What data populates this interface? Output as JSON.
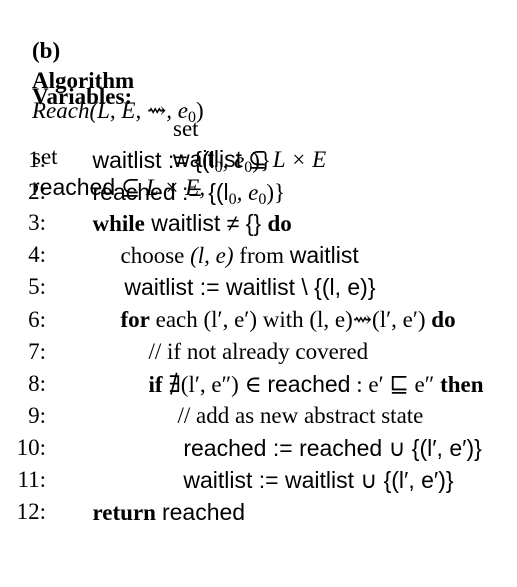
{
  "caption": {
    "label": "(b)",
    "keyword": "Algorithm",
    "name": "Reach",
    "params": "(L, E, ⇝, e",
    "param_sub": "0",
    "close": ")"
  },
  "variables": {
    "keyword": "Variables:",
    "line1_set": "set",
    "line1_name": "reached",
    "line1_rest": " ⊆ L × E,",
    "line2_set": "set",
    "line2_name": "waitlist",
    "line2_rest": " ⊆ L × E"
  },
  "lines": [
    {
      "num": "1:",
      "a": "waitlist := {(l",
      "a_sub": "0",
      "b": ", e",
      "b_sub": "0",
      "c": ")}"
    },
    {
      "num": "2:",
      "a": "reached := {(l",
      "a_sub": "0",
      "b": ", e",
      "b_sub": "0",
      "c": ")}"
    },
    {
      "num": "3:",
      "kw": "while",
      "a": " waitlist ≠ {} ",
      "kw2": "do"
    },
    {
      "num": "4:",
      "a": "choose ",
      "b": "(l, e)",
      "c": " from ",
      "d": "waitlist"
    },
    {
      "num": "5:",
      "a": "waitlist := waitlist \\ {(l, e)}"
    },
    {
      "num": "6:",
      "kw": "for",
      "a": " each (l′, e′) with (l, e)⇝(l′, e′) ",
      "kw2": "do"
    },
    {
      "num": "7:",
      "a": "// if not already covered"
    },
    {
      "num": "8:",
      "kw": "if",
      "a": " ∄(l′, e″) ∈ ",
      "b": "reached",
      "c": " : e′ ⊑ e″ ",
      "kw2": "then"
    },
    {
      "num": "9:",
      "a": "// add as new abstract state"
    },
    {
      "num": "10:",
      "a": "reached := reached ∪ {(l′, e′)}"
    },
    {
      "num": "11:",
      "a": "waitlist := waitlist ∪ {(l′, e′)}"
    },
    {
      "num": "12:",
      "kw": "return",
      "a": "reached"
    }
  ]
}
